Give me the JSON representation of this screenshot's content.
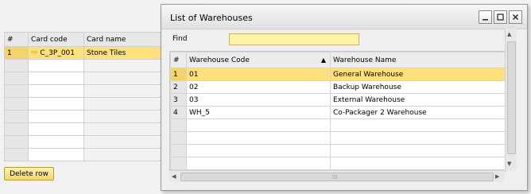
{
  "background_grid": {
    "headers": [
      "#",
      "Card code",
      "Card name"
    ],
    "rows": [
      {
        "num": "1",
        "card_code": "C_3P_001",
        "card_name": "Stone Tiles"
      }
    ],
    "delete_button_label": "Delete row"
  },
  "dialog": {
    "title": "List of Warehouses",
    "find_label": "Find",
    "find_value": "",
    "columns": [
      "#",
      "Warehouse Code",
      "Warehouse Name"
    ],
    "rows": [
      {
        "num": "1",
        "code": "01",
        "name": "General Warehouse"
      },
      {
        "num": "2",
        "code": "02",
        "name": "Backup Warehouse"
      },
      {
        "num": "3",
        "code": "03",
        "name": "External Warehouse"
      },
      {
        "num": "4",
        "code": "WH_5",
        "name": "Co-Packager 2 Warehouse"
      }
    ]
  },
  "colors": {
    "selection": "#ffe07a",
    "find_field": "#fff3a8"
  },
  "icons": [
    "arrow-link-icon",
    "sort-ascending-icon",
    "minimize-icon",
    "maximize-icon",
    "close-icon"
  ]
}
